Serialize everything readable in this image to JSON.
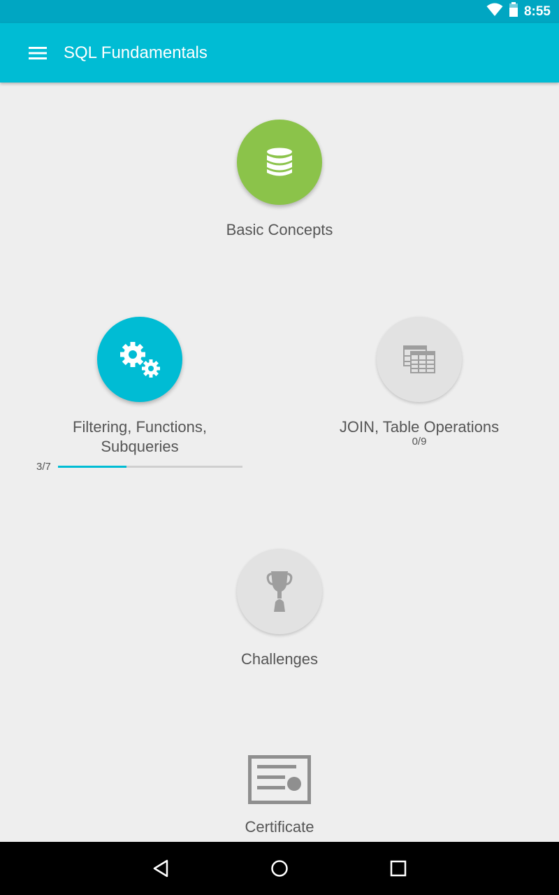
{
  "status": {
    "time": "8:55"
  },
  "app": {
    "title": "SQL Fundamentals"
  },
  "modules": [
    {
      "label": "Basic Concepts",
      "icon": "database-icon",
      "state": "completed",
      "color": "#8bc34a"
    },
    {
      "label_line1": "Filtering, Functions,",
      "label_line2": "Subqueries",
      "icon": "gears-icon",
      "state": "in-progress",
      "color": "#00bcd4",
      "progress_text": "3/7",
      "progress_fraction": 0.3714
    },
    {
      "label": "JOIN, Table Operations",
      "icon": "table-icon",
      "state": "locked",
      "progress_text": "0/9"
    },
    {
      "label": "Challenges",
      "icon": "trophy-icon",
      "state": "locked"
    }
  ],
  "certificate": {
    "label": "Certificate",
    "icon": "certificate-icon"
  },
  "colors": {
    "primary": "#00bcd4",
    "primary_dark": "#00a6c2",
    "accent_green": "#8bc34a",
    "background": "#eeeeee"
  }
}
